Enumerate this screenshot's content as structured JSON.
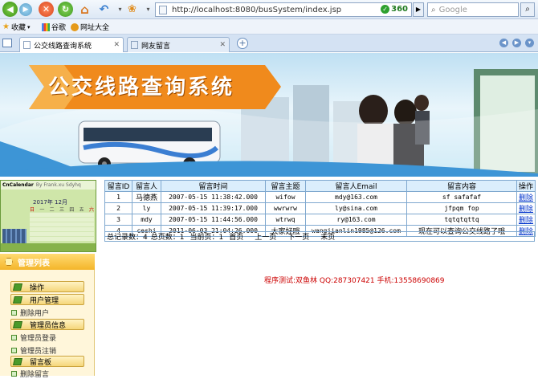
{
  "browser": {
    "url": "http://localhost:8080/busSystem/index.jsp",
    "search_placeholder": "Google",
    "brand": "360",
    "bookmarks": [
      "收藏",
      "谷歌",
      "网址大全"
    ],
    "tabs": [
      {
        "label": "公交线路查询系统",
        "active": true
      },
      {
        "label": "网友留言",
        "active": false
      }
    ]
  },
  "banner": {
    "title": "公交线路查询系统"
  },
  "calendar": {
    "label": "CnCalendar",
    "sublabel": "By Frank.xu Sdyhq",
    "year_month": "2017年 12月",
    "weekdays": [
      "日",
      "一",
      "二",
      "三",
      "四",
      "五",
      "六"
    ]
  },
  "sidebar": {
    "header": "管理列表",
    "groups": [
      {
        "label": "操作"
      },
      {
        "label": "用户管理"
      },
      {
        "label": "管理员信息"
      },
      {
        "label": "留言板"
      }
    ],
    "items": [
      "删除用户",
      "管理员登录",
      "管理员注销",
      "删除留言"
    ]
  },
  "table": {
    "headers": [
      "留言ID",
      "留言人",
      "留言时间",
      "留言主题",
      "留言人Email",
      "留言内容",
      "操作"
    ],
    "rows": [
      {
        "id": "1",
        "name": "马德燕",
        "time": "2007-05-15 11:38:42.000",
        "subject": "wifow",
        "email": "mdy@163.com",
        "content": "sf safafaf",
        "action": "删除"
      },
      {
        "id": "2",
        "name": "ly",
        "time": "2007-05-15 11:39:17.000",
        "subject": "wwrwrw",
        "email": "ly@sina.com",
        "content": "jfpqm fop",
        "action": "删除"
      },
      {
        "id": "3",
        "name": "mdy",
        "time": "2007-05-15 11:44:56.000",
        "subject": "wtrwq",
        "email": "ry@163.com",
        "content": "tqtqtqttq",
        "action": "删除"
      },
      {
        "id": "4",
        "name": "ceshi",
        "time": "2011-06-03 21:04:26.000",
        "subject": "大家好哦",
        "email": "wangjianlin1985@126.com",
        "content": "现在可以查询公交线路了哦",
        "action": "删除"
      }
    ]
  },
  "pager": {
    "total": "总记录数：4",
    "pages": "总页数：1",
    "current": "当前页：1",
    "first": "首页",
    "prev": "上一页",
    "next": "下一页",
    "last": "末页"
  },
  "credit": "程序测试:双鱼林 QQ:287307421 手机:13558690869"
}
